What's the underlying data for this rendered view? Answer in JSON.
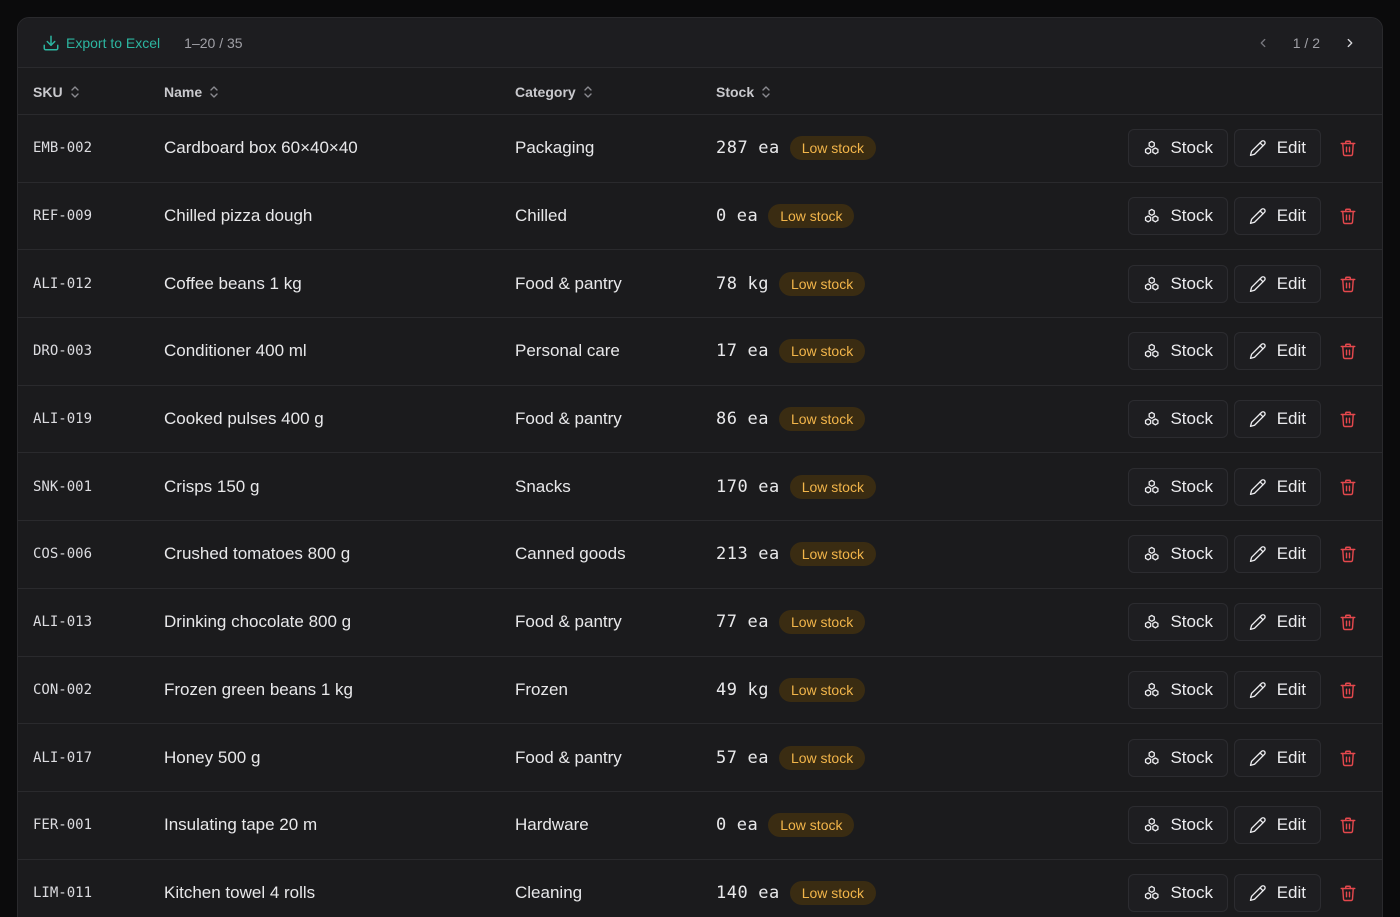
{
  "toolbar": {
    "export_label": "Export to Excel",
    "range_label": "1–20 / 35",
    "page_label": "1 / 2"
  },
  "columns": {
    "sku": "SKU",
    "name": "Name",
    "category": "Category",
    "stock": "Stock"
  },
  "row_labels": {
    "stock_button": "Stock",
    "edit_button": "Edit"
  },
  "colors": {
    "accent": "#2cb5a0",
    "badge_text": "#f2b54a",
    "badge_bg": "#3a2c12",
    "danger": "#e5484d"
  },
  "rows": [
    {
      "sku": "EMB-002",
      "name": "Cardboard box 60×40×40",
      "category": "Packaging",
      "qty": "287",
      "unit": "ea",
      "badge": "Low stock"
    },
    {
      "sku": "REF-009",
      "name": "Chilled pizza dough",
      "category": "Chilled",
      "qty": "0",
      "unit": "ea",
      "badge": "Low stock"
    },
    {
      "sku": "ALI-012",
      "name": "Coffee beans 1 kg",
      "category": "Food & pantry",
      "qty": "78",
      "unit": "kg",
      "badge": "Low stock"
    },
    {
      "sku": "DRO-003",
      "name": "Conditioner 400 ml",
      "category": "Personal care",
      "qty": "17",
      "unit": "ea",
      "badge": "Low stock"
    },
    {
      "sku": "ALI-019",
      "name": "Cooked pulses 400 g",
      "category": "Food & pantry",
      "qty": "86",
      "unit": "ea",
      "badge": "Low stock"
    },
    {
      "sku": "SNK-001",
      "name": "Crisps 150 g",
      "category": "Snacks",
      "qty": "170",
      "unit": "ea",
      "badge": "Low stock"
    },
    {
      "sku": "COS-006",
      "name": "Crushed tomatoes 800 g",
      "category": "Canned goods",
      "qty": "213",
      "unit": "ea",
      "badge": "Low stock"
    },
    {
      "sku": "ALI-013",
      "name": "Drinking chocolate 800 g",
      "category": "Food & pantry",
      "qty": "77",
      "unit": "ea",
      "badge": "Low stock"
    },
    {
      "sku": "CON-002",
      "name": "Frozen green beans 1 kg",
      "category": "Frozen",
      "qty": "49",
      "unit": "kg",
      "badge": "Low stock"
    },
    {
      "sku": "ALI-017",
      "name": "Honey 500 g",
      "category": "Food & pantry",
      "qty": "57",
      "unit": "ea",
      "badge": "Low stock"
    },
    {
      "sku": "FER-001",
      "name": "Insulating tape 20 m",
      "category": "Hardware",
      "qty": "0",
      "unit": "ea",
      "badge": "Low stock"
    },
    {
      "sku": "LIM-011",
      "name": "Kitchen towel 4 rolls",
      "category": "Cleaning",
      "qty": "140",
      "unit": "ea",
      "badge": "Low stock"
    }
  ]
}
